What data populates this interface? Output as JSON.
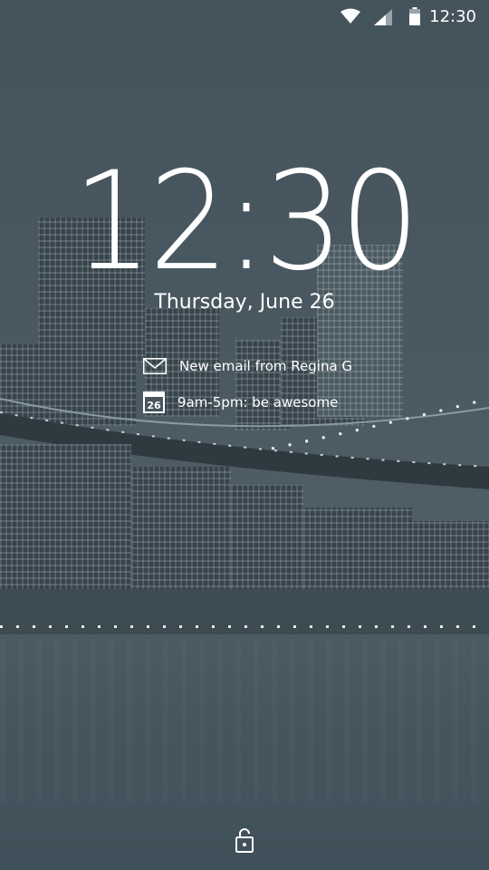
{
  "status_bar": {
    "time": "12:30",
    "icons": [
      "wifi-icon",
      "cell-signal-icon",
      "battery-icon"
    ]
  },
  "clock": {
    "time": "12:30",
    "date": "Thursday, June 26"
  },
  "notifications": [
    {
      "icon": "mail-icon",
      "text": "New email from Regina G"
    },
    {
      "icon": "calendar-icon",
      "icon_text": "26",
      "text": "9am-5pm: be awesome"
    }
  ],
  "lock": {
    "icon": "lock-icon"
  },
  "colors": {
    "background": "#46555e",
    "text": "#ffffff"
  }
}
